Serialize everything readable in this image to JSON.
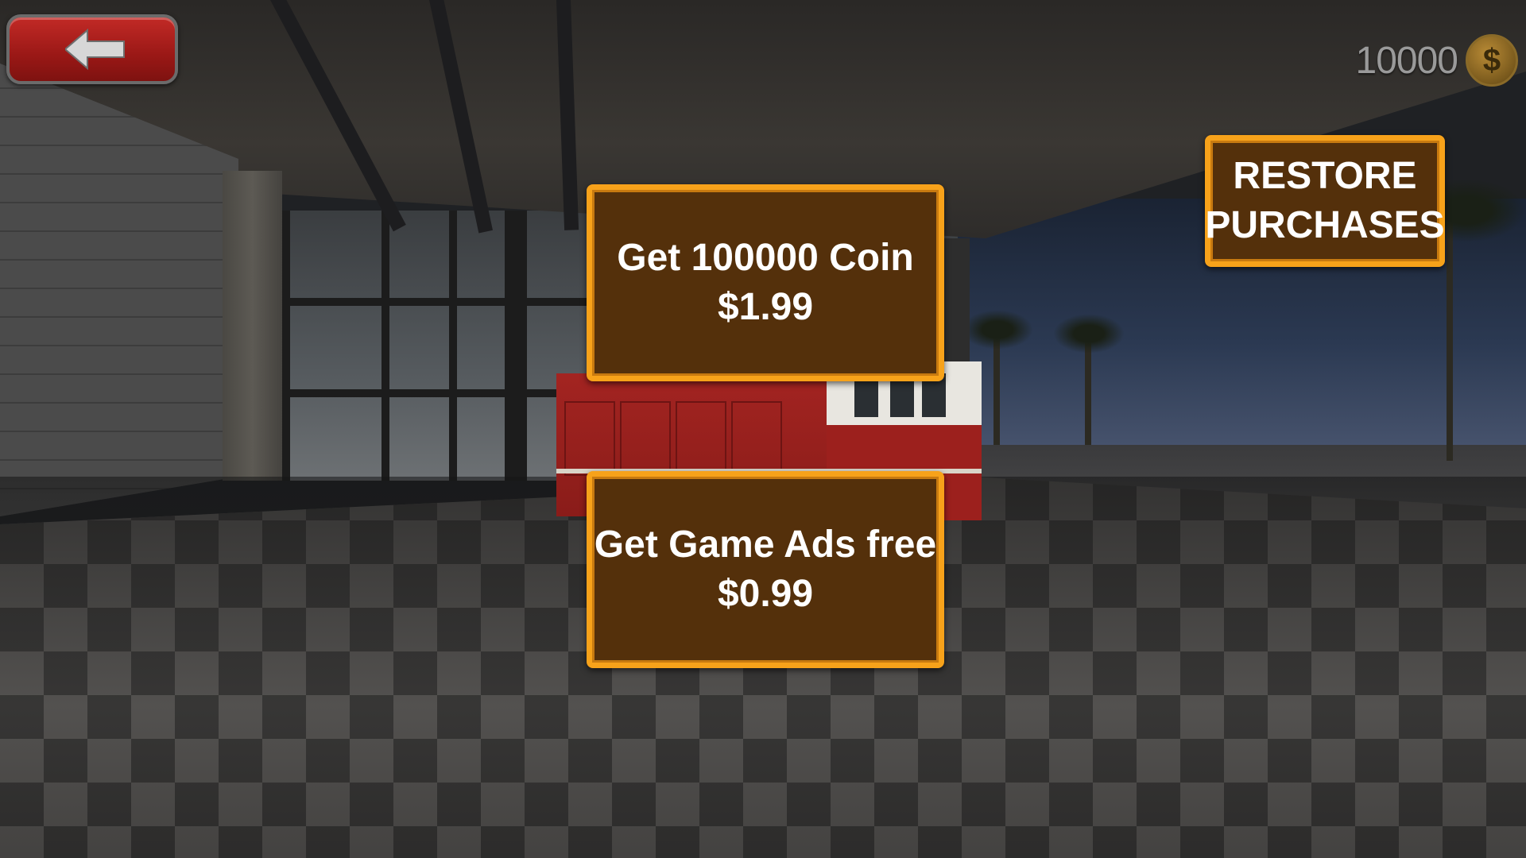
{
  "header": {
    "coin_balance": "10000",
    "coin_icon_glyph": "$",
    "back_button_icon": "arrow-left-icon"
  },
  "shop": {
    "coin_pack": {
      "title": "Get 100000 Coin",
      "price": "$1.99"
    },
    "remove_ads": {
      "title": "Get Game Ads free",
      "price": "$0.99"
    },
    "restore": {
      "line1": "RESTORE",
      "line2": "PURCHASES"
    }
  },
  "colors": {
    "button_fill": "#54300b",
    "button_border": "#f7a21a",
    "back_button": "#b0201d",
    "coin_text": "#9a9a9a",
    "coin_icon": "#8a6a28"
  }
}
